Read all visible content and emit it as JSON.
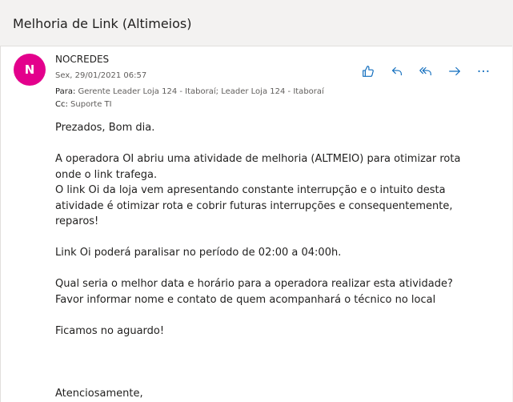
{
  "subject": "Melhoria de Link (Altimeios)",
  "message": {
    "avatar_initial": "N",
    "avatar_color": "#e3008c",
    "sender": "NOCREDES",
    "date": "Sex, 29/01/2021 06:57",
    "to_label": "Para:",
    "to_value": "Gerente Leader Loja 124 - Itaboraí; Leader Loja 124 - Itaboraí",
    "cc_label": "Cc:",
    "cc_value": "Suporte TI",
    "actions": [
      {
        "name": "like",
        "icon": "thumbs-up-icon"
      },
      {
        "name": "reply",
        "icon": "reply-icon"
      },
      {
        "name": "reply-all",
        "icon": "reply-all-icon"
      },
      {
        "name": "forward",
        "icon": "forward-icon"
      },
      {
        "name": "more",
        "icon": "more-icon"
      }
    ],
    "body": {
      "greeting": "Prezados, Bom dia.",
      "p1_line1": "A operadora OI abriu uma atividade de melhoria (ALTMEIO) para otimizar rota",
      "p1_line2": "onde o link trafega.",
      "p2_line1": "O link Oi da loja vem apresentando constante interrupção e o intuito desta",
      "p2_line2": "atividade é otimizar rota e cobrir futuras interrupções e consequentemente,",
      "p2_line3": "reparos!",
      "p3": "Link Oi poderá paralisar no período de 02:00 a 04:00h.",
      "p4_line1": "Qual seria o melhor data e horário para a operadora realizar esta atividade?",
      "p4_line2": "Favor informar nome e contato de quem acompanhará o técnico no local",
      "p5": "Ficamos no aguardo!",
      "closing": "Atenciosamente,"
    }
  }
}
